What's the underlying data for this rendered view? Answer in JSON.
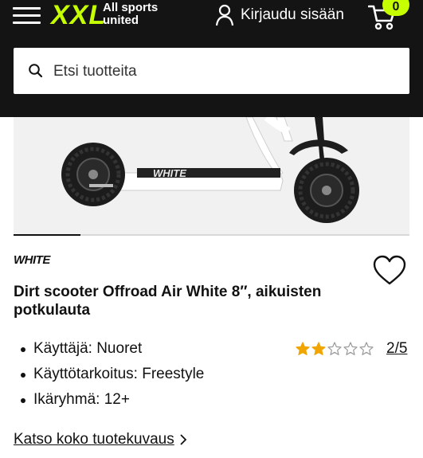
{
  "header": {
    "logo_text": "XXL",
    "tagline": "All sports united",
    "login_label": "Kirjaudu sisään",
    "cart_count": "0",
    "colors": {
      "background": "#141414",
      "accent": "#c6ff00"
    },
    "icons": [
      "hamburger-icon",
      "user-icon",
      "cart-icon"
    ]
  },
  "search": {
    "placeholder": "Etsi tuotteita",
    "icon": "search-icon"
  },
  "product": {
    "image_carousel_progress": 0.17,
    "brand": "WHITE",
    "title": "Dirt scooter Offroad Air White 8″, aikuisten potkulauta",
    "specs": [
      "Käyttäjä: Nuoret",
      "Käyttötarkoitus: Freestyle",
      "Ikäryhmä: 12+"
    ],
    "rating": {
      "value": 2,
      "max": 5,
      "text": "2/5",
      "star_color": "#f0a500"
    },
    "full_description_label": "Katso koko tuotekuvaus",
    "favorite_icon": "heart-icon"
  }
}
